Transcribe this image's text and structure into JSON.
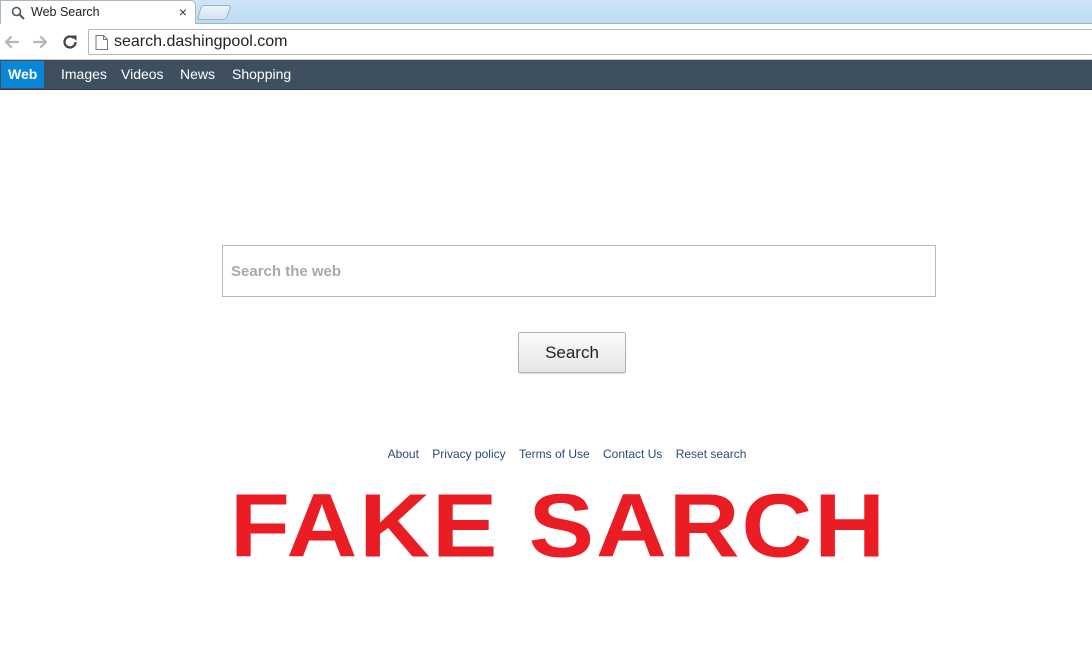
{
  "browser": {
    "tab": {
      "title": "Web Search",
      "close_glyph": "×",
      "icon": "search-icon"
    },
    "address_bar": {
      "url": "search.dashingpool.com",
      "icon": "page-icon"
    },
    "nav_icons": [
      "back-arrow-icon",
      "forward-arrow-icon",
      "reload-icon"
    ]
  },
  "site_nav": {
    "items": [
      {
        "label": "Web",
        "active": true
      },
      {
        "label": "Images"
      },
      {
        "label": "Videos"
      },
      {
        "label": "News"
      },
      {
        "label": "Shopping"
      }
    ],
    "active_color": "#0a86d9",
    "bar_color": "#3e5060"
  },
  "search": {
    "placeholder": "Search the web",
    "button_label": "Search"
  },
  "footer": {
    "links": [
      "About",
      "Privacy policy",
      "Terms of Use",
      "Contact Us",
      "Reset search"
    ],
    "link_color": "#2a4a78"
  },
  "overlay": {
    "text": "FAKE SARCH",
    "color": "#ea1c24"
  }
}
